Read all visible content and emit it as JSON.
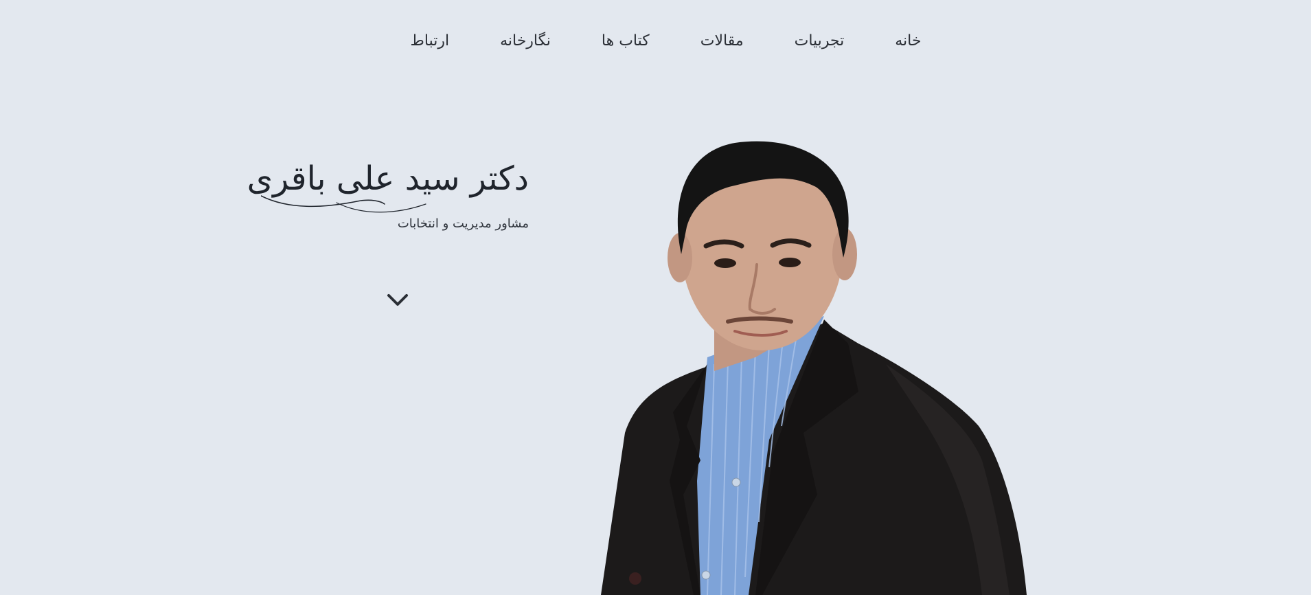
{
  "nav": {
    "items": [
      {
        "label": "خانه"
      },
      {
        "label": "تجربیات"
      },
      {
        "label": "مقالات"
      },
      {
        "label": "کتاب ها"
      },
      {
        "label": "نگارخانه"
      },
      {
        "label": "ارتباط"
      }
    ]
  },
  "hero": {
    "name": "دکتر سید علی باقری",
    "subtitle": "مشاور مدیریت و انتخابات",
    "scroll_icon": "chevron-down-icon"
  },
  "portrait": {
    "icon": "portrait-photo",
    "colors": {
      "background": "#e3e8ef",
      "suit": "#1c1a1a",
      "shirt": "#7ea3d8",
      "skin": "#cfa58e",
      "hair": "#141414"
    }
  }
}
